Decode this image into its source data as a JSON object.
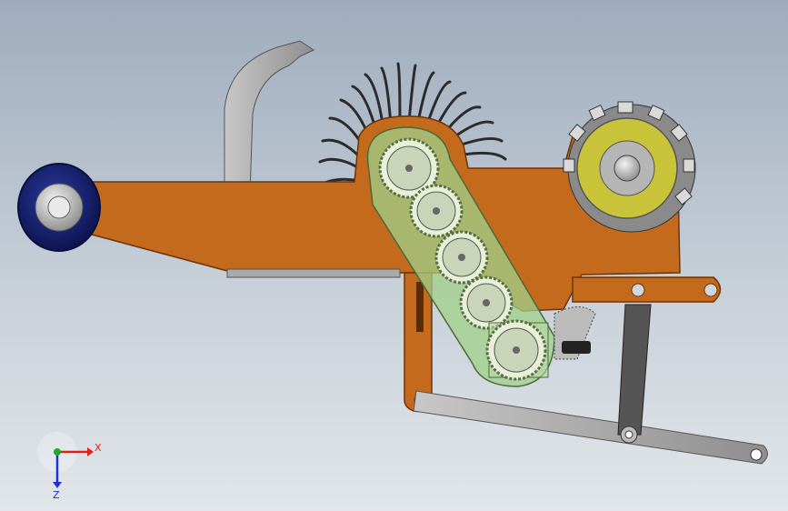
{
  "triad": {
    "x_label": "X",
    "z_label": "Z",
    "colors": {
      "x": "#e0201c",
      "y": "#25a82a",
      "z": "#1c2fd8"
    }
  },
  "colors": {
    "frame": "#c46a1c",
    "frame_edge": "#6b3408",
    "chain_housing": "#9fd08a",
    "gear": "#c9d4b8",
    "steel": "#a8a8a8",
    "steel_dark": "#444444",
    "wheel_tire": "#17206e",
    "roller_hub": "#c9c33a",
    "roller_teeth": "#d9d9d9"
  }
}
